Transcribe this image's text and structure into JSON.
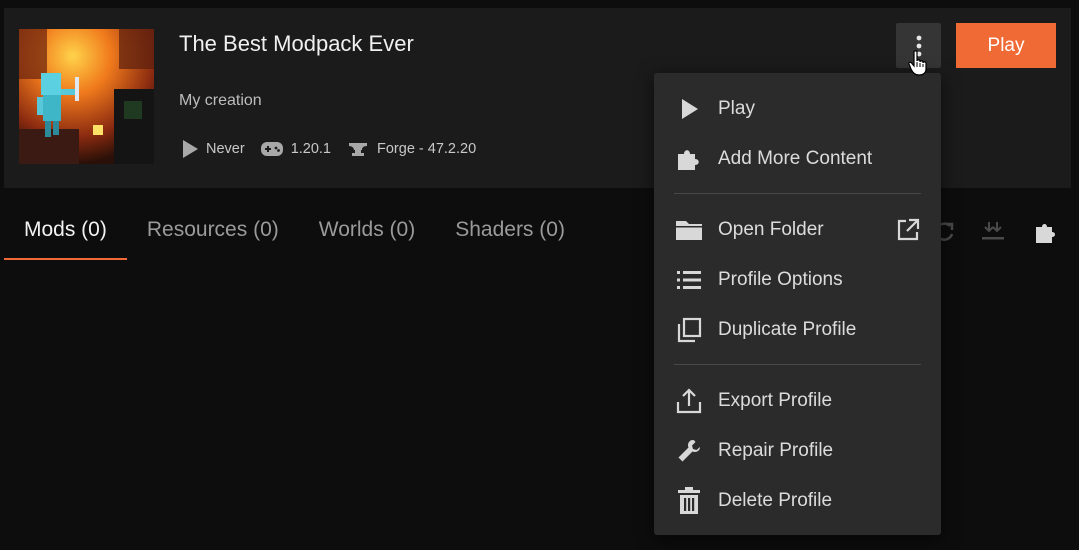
{
  "profile": {
    "title": "The Best Modpack Ever",
    "description": "My creation",
    "last_played": "Never",
    "game_version": "1.20.1",
    "loader": "Forge - 47.2.20"
  },
  "actions": {
    "play_label": "Play",
    "more_icon": "vertical-dots-icon"
  },
  "tabs": [
    {
      "label": "Mods (0)",
      "active": true
    },
    {
      "label": "Resources (0)",
      "active": false
    },
    {
      "label": "Worlds (0)",
      "active": false
    },
    {
      "label": "Shaders (0)",
      "active": false
    }
  ],
  "tools": {
    "icons": [
      "refresh-icon",
      "download-icon",
      "puzzle-icon"
    ]
  },
  "menu": {
    "items": [
      {
        "label": "Play",
        "icon": "play-icon"
      },
      {
        "label": "Add More Content",
        "icon": "puzzle-icon"
      },
      {
        "label": "Open Folder",
        "icon": "folder-icon",
        "trailing_icon": "external-link-icon"
      },
      {
        "label": "Profile Options",
        "icon": "list-icon"
      },
      {
        "label": "Duplicate Profile",
        "icon": "duplicate-icon"
      },
      {
        "label": "Export Profile",
        "icon": "upload-icon"
      },
      {
        "label": "Repair Profile",
        "icon": "wrench-icon"
      },
      {
        "label": "Delete Profile",
        "icon": "trash-icon"
      }
    ]
  },
  "colors": {
    "accent": "#f06a35",
    "background": "#0d0d0d",
    "card": "#1b1b1b",
    "menu": "#2b2b2b"
  }
}
